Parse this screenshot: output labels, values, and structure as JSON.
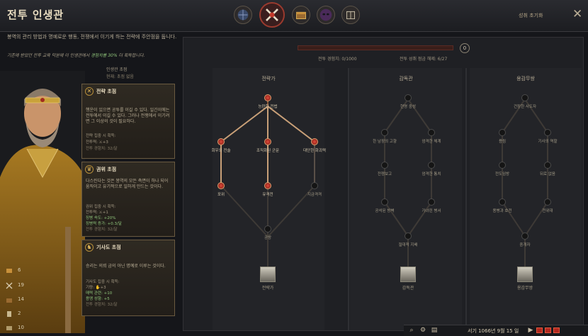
{
  "header": {
    "title": "전투 인생관",
    "reset_label": "성취 초기화",
    "close_label": "✕",
    "tabs": [
      {
        "name": "lifestyle-diplomacy",
        "icon": "globe-icon"
      },
      {
        "name": "lifestyle-martial",
        "icon": "crossed-swords-icon",
        "active": true
      },
      {
        "name": "lifestyle-stewardship",
        "icon": "chest-icon"
      },
      {
        "name": "lifestyle-intrigue",
        "icon": "mask-icon"
      },
      {
        "name": "lifestyle-learning",
        "icon": "book-icon"
      }
    ]
  },
  "description": {
    "text": "봉역의 관리 방법과 명예로운 행동, 전쟁에서 이기게 하는 전략에 주안점을 둡니다.",
    "bonus_prefix": "기존에 받았던 전투 교육 덕분에 이 인생관에서 ",
    "bonus_highlight": "경험치를 30%",
    "bonus_suffix": " 더 획득합니다."
  },
  "focus_panel": {
    "title": "인생관 초점",
    "subtitle": "현재: 초점 없음",
    "cards": [
      {
        "icon": "crossed-swords-icon",
        "title": "전략 초점",
        "desc": "행운이 있으면 공투를 이길 수 있다. 일긴이에는 전투에서 이길 수 있다. 그러나 전쟁에서 이기려면 그 이상의 것이 필요하다.",
        "stats": [
          "전략 집중 시 획득:",
          "전투력: ⚔+3",
          "전투 경험치: 32/달"
        ]
      },
      {
        "icon": "crown-icon",
        "title": "권위 초점",
        "desc": "다스린다는 것은 봉역의 모든 측면이 하나 되어 움직이고 유기적으로 일하게 만드는 것이다.",
        "stats": [
          "권위 집중 시 획득:",
          "전투력: ⚔+1",
          "징병 속도: +20%",
          "징병력 증가: +0.3/달",
          "전투 경험치: 32/달"
        ]
      },
      {
        "icon": "knight-icon",
        "title": "기사도 초점",
        "desc": "승리는 의뢰 금의 아닌 명예로 이루는 것이다.",
        "stats": [
          "기사도 집중 시 획득:",
          "기량: ✋+3",
          "매력 관련: +10",
          "용맹 성향: +5",
          "전투 경험치: 32/달"
        ]
      }
    ]
  },
  "resources": [
    {
      "icon": "gold-icon",
      "value": "6"
    },
    {
      "icon": "crossed-swords-icon",
      "value": "19"
    },
    {
      "icon": "treasury-icon",
      "value": "14"
    },
    {
      "icon": "scroll-icon",
      "value": "2"
    },
    {
      "icon": "book-icon",
      "value": "10"
    }
  ],
  "progress": {
    "level": "0",
    "fill_fraction": 0.0,
    "xp_text": "전투 경험치: 0/1000",
    "perk_text": "전투 성취 점금 해제: 6/27"
  },
  "trees": [
    {
      "title": "전략가",
      "emblem_label": "전략가",
      "nodes": [
        {
          "id": "a1",
          "label": "능란한 전법",
          "active": true
        },
        {
          "id": "a2",
          "label": "회우의 전술",
          "active": true
        },
        {
          "id": "a3",
          "label": "조직화된 군문",
          "active": true
        },
        {
          "id": "a4",
          "label": "대단한 화괴력",
          "active": true
        },
        {
          "id": "a5",
          "label": "포위",
          "active": true
        },
        {
          "id": "a6",
          "label": "유격전",
          "active": true
        },
        {
          "id": "a7",
          "label": "지금격격",
          "active": false
        },
        {
          "id": "a8",
          "label": "공방",
          "active": false
        }
      ]
    },
    {
      "title": "감독관",
      "emblem_label": "감독관",
      "nodes": [
        {
          "id": "b1",
          "label": "현명 중성",
          "active": false
        },
        {
          "id": "b2",
          "label": "한 남장의 고향",
          "active": false
        },
        {
          "id": "b3",
          "label": "엄격한 체계",
          "active": false
        },
        {
          "id": "b4",
          "label": "전쟁보고",
          "active": false
        },
        {
          "id": "b5",
          "label": "엄격한 통치",
          "active": false
        },
        {
          "id": "b6",
          "label": "공석된 방벽",
          "active": false
        },
        {
          "id": "b7",
          "label": "가녀린 병서",
          "active": false
        },
        {
          "id": "b8",
          "label": "절대적 지배",
          "active": false
        }
      ]
    },
    {
      "title": "용감무쌍",
      "emblem_label": "용감무쌍",
      "nodes": [
        {
          "id": "c1",
          "label": "건장한 사도자",
          "active": false
        },
        {
          "id": "c2",
          "label": "용림",
          "active": false
        },
        {
          "id": "c3",
          "label": "기사의 역할",
          "active": false
        },
        {
          "id": "c4",
          "label": "전도임방",
          "active": false
        },
        {
          "id": "c5",
          "label": "뒤로 없음",
          "active": false
        },
        {
          "id": "c6",
          "label": "용병과 호전",
          "active": false
        },
        {
          "id": "c7",
          "label": "전위대",
          "active": false
        },
        {
          "id": "c8",
          "label": "중개자",
          "active": false
        }
      ]
    }
  ],
  "bottom_bar": {
    "date": "서기 1066년 9월 15 일",
    "icons": [
      "search-icon",
      "gear-icon",
      "book-icon",
      "play-icon"
    ]
  },
  "colors": {
    "accent_red": "#b3291f",
    "gold": "#e0b75a",
    "highlight_green": "#8fc47a"
  }
}
